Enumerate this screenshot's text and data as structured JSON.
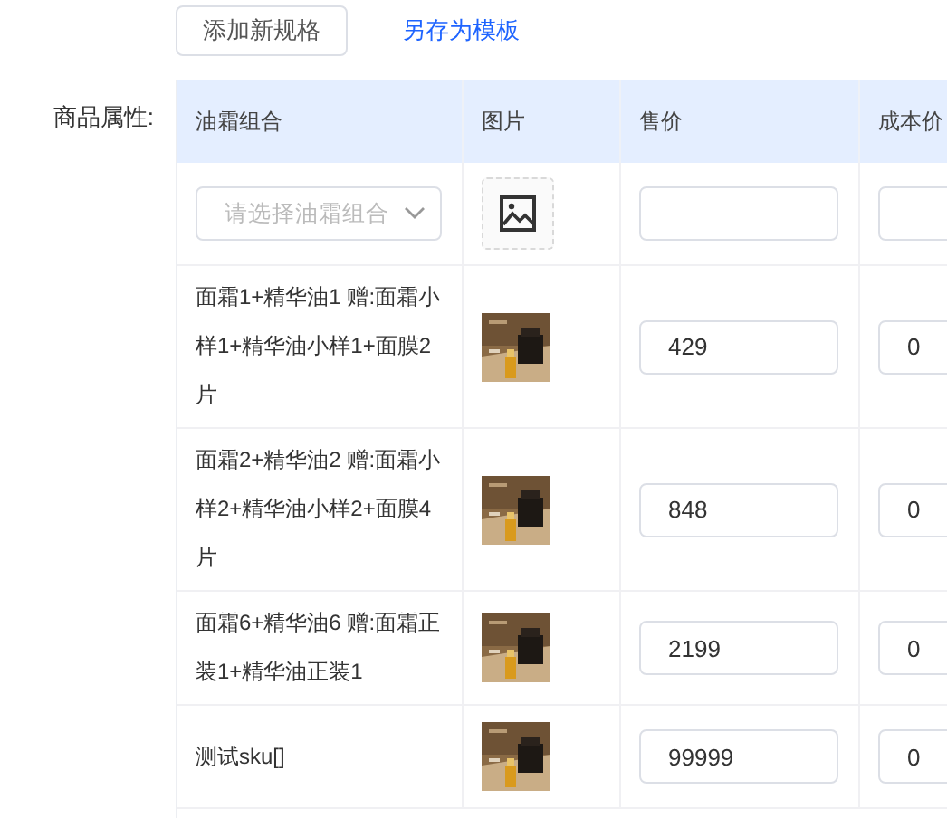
{
  "actions": {
    "add_button": "添加新规格",
    "template_link": "另存为模板"
  },
  "section_label": "商品属性:",
  "columns": [
    "油霜组合",
    "图片",
    "售价",
    "成本价"
  ],
  "filter_row": {
    "combo_placeholder": "请选择油霜组合"
  },
  "rows": [
    {
      "name": "面霜1+精华油1 赠:面霜小样1+精华油小样1+面膜2片",
      "price": "429",
      "cost": "0"
    },
    {
      "name": "面霜2+精华油2 赠:面霜小样2+精华油小样2+面膜4片",
      "price": "848",
      "cost": "0"
    },
    {
      "name": "面霜6+精华油6 赠:面霜正装1+精华油正装1",
      "price": "2199",
      "cost": "0"
    },
    {
      "name": "测试sku[]",
      "price": "99999",
      "cost": "0"
    }
  ]
}
